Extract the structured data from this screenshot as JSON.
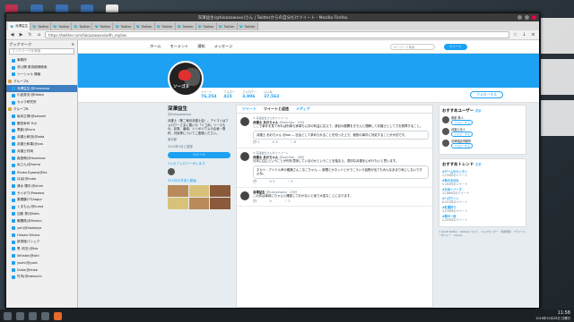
{
  "window": {
    "title": "深澤益生(@fukazawaxx)さん | Twitterからの自分だけツイート - Mozilla Firefox"
  },
  "tabs": [
    {
      "label": "深澤益生"
    },
    {
      "label": "Twitter"
    },
    {
      "label": "Twitter"
    },
    {
      "label": "Twitter"
    },
    {
      "label": "Twitter"
    },
    {
      "label": "Twitter"
    },
    {
      "label": "Twitter"
    },
    {
      "label": "Twitter"
    },
    {
      "label": "Twitter"
    },
    {
      "label": "Twitter"
    },
    {
      "label": "Twitter"
    },
    {
      "label": "Twitter"
    }
  ],
  "address": {
    "url": "https://twitter.com/fukazawaxx/with_replies"
  },
  "sidebar": {
    "title": "ブックマーク",
    "search_placeholder": "ブックマークを検索",
    "items": [
      {
        "label": "事務所",
        "type": "item"
      },
      {
        "label": "非公開 原真樹様検索",
        "type": "item"
      },
      {
        "label": "ソーシャル 情報",
        "type": "item"
      },
      {
        "label": "グループA",
        "type": "folder"
      },
      {
        "label": "深澤益生(@fukazawa",
        "type": "item",
        "selected": true
      },
      {
        "label": "小倉秀夫(@Hideo",
        "type": "item"
      },
      {
        "label": "カメラ研究所",
        "type": "item"
      },
      {
        "label": "グループB",
        "type": "folder"
      },
      {
        "label": "坂本正博(@sakami",
        "type": "item"
      },
      {
        "label": "鶴田幸司 Yuji",
        "type": "item"
      },
      {
        "label": "黒影(@kuro",
        "type": "item"
      },
      {
        "label": "弁護士和田(@wda",
        "type": "item"
      },
      {
        "label": "弁護士和喜(@yos",
        "type": "item"
      },
      {
        "label": "弁護士村岡",
        "type": "item"
      },
      {
        "label": "森島萌(@moemoe",
        "type": "item"
      },
      {
        "label": "浜さん(@hama",
        "type": "item"
      },
      {
        "label": "Shoko Egawa(@ha",
        "type": "item"
      },
      {
        "label": "ほぼ(@hobo",
        "type": "item"
      },
      {
        "label": "清水 陽平(@shim",
        "type": "item"
      },
      {
        "label": "サイボウ(Poweow",
        "type": "item"
      },
      {
        "label": "素養鶴(??(Aogur",
        "type": "item"
      },
      {
        "label": "くまもん(@kuma",
        "type": "item"
      },
      {
        "label": "加藤 泰(@kato",
        "type": "item"
      },
      {
        "label": "戦闘員(@Hamur",
        "type": "item"
      },
      {
        "label": "yoh(@hawkeye",
        "type": "item"
      },
      {
        "label": "Hiroaki Kihara",
        "type": "item"
      },
      {
        "label": "新書館パンェク",
        "type": "item"
      },
      {
        "label": "黒 可田 (@kia",
        "type": "item"
      },
      {
        "label": "Whistle(@whi",
        "type": "item"
      },
      {
        "label": "yoshi(@yosh",
        "type": "item"
      },
      {
        "label": "Duke(@duke",
        "type": "item"
      },
      {
        "label": "竹内(@takeuchi",
        "type": "item"
      }
    ]
  },
  "twitter_nav": {
    "items": [
      "ホーム",
      "モーメント",
      "通知",
      "メッセージ"
    ],
    "search_placeholder": "キーワード検索",
    "tweet_button": "ツイート"
  },
  "profile": {
    "avatar_text": "ソーゴヌ",
    "name": "深澤益生",
    "handle": "@fukazawaxx",
    "bio": "弁護士（第二東京弁護士会）。アイコンはフォロワーさまに戴いた「ソゴ弁」ソースもの。記事、番組、シンポジウムの企画・取材、対談等についてご連絡ください。",
    "location": "東京都",
    "joined": "2010年7月に登録",
    "tweet_button": "ツイート",
    "followers_you_know": "2人のフォロワーがいます",
    "media_label": "201件の写真と動画",
    "stats": [
      {
        "label": "ツイート",
        "value": "76,254"
      },
      {
        "label": "フォロー",
        "value": "415"
      },
      {
        "label": "フォロワー",
        "value": "3,906"
      },
      {
        "label": "いいね",
        "value": "37,563"
      }
    ],
    "follow_button": "フォローする"
  },
  "timeline": {
    "tabs": [
      "ツイート",
      "ツイートと返信",
      "メディア"
    ],
    "tweets": [
      {
        "retweet": "深澤益生さんがリツイート",
        "name": "弁護士 あおちゃん",
        "handle": "@aoichan · 20分",
        "text": "ここで事件を見てみれば刑事も家事も公共の利益に応えて、訴訟の展開をきちんと理解して弁護士として力を発揮すること。",
        "quote": "弁護士 あおちゃん @aoi — 社会として求められることを知った上で、個別の事件に対処することが大切です。",
        "actions": [
          "1",
          "3",
          "8"
        ]
      },
      {
        "retweet": "深澤益生さんがリツイート",
        "name": "弁護士 あおちゃん",
        "handle": "@aoichan · 28分",
        "text": "日本に住むということが何を意味しているのかということを踏まえ、適切な弁護を心がけたいと思います。",
        "quote": "ネカト・アイドル声の鑑識さんこなこちゃん — 新聞とかネットとかでこういう話題が出てもみんなあまり気にしないですよね。",
        "actions": [
          "",
          "2",
          "5"
        ]
      },
      {
        "retweet": "",
        "name": "深澤益生",
        "handle": "@fukazawaxx · 29分",
        "text": "この件は事前にちゃんと確認しておかないと後で大変なことになります。",
        "quote": "",
        "actions": [
          "",
          "",
          "1"
        ]
      }
    ]
  },
  "who_to_follow": {
    "title": "おすすめユーザー",
    "refresh": "更新",
    "users": [
      {
        "name": "菅原 秀人",
        "button": "フォローする"
      },
      {
        "name": "弁護士法人",
        "button": "フォローする"
      },
      {
        "name": "法律相談事務所",
        "button": "フォローする"
      }
    ]
  },
  "trends": {
    "title": "おすすめトレンド",
    "change": "変更",
    "items": [
      {
        "name": "#ゲームのカンタン",
        "count": "1,234件のツイート"
      },
      {
        "name": "#秋の大切な",
        "count": "5,102件のツイート"
      },
      {
        "name": "#日本シリーズ",
        "count": "12,880件のツイート"
      },
      {
        "name": "#ハロウィン",
        "count": "8,421件のツイート"
      },
      {
        "name": "#紅葉狩り",
        "count": "3,019件のツイート"
      },
      {
        "name": "#朝の一枚",
        "count": "2,205件のツイート"
      }
    ],
    "footer": "© 2018 Twitter　Twitterについて　ヘルプセンター　利用規約　プライバシーポリシー　Cookie"
  },
  "taskbar": {
    "time": "11:58",
    "date": "2018年10月28日 日曜日"
  }
}
